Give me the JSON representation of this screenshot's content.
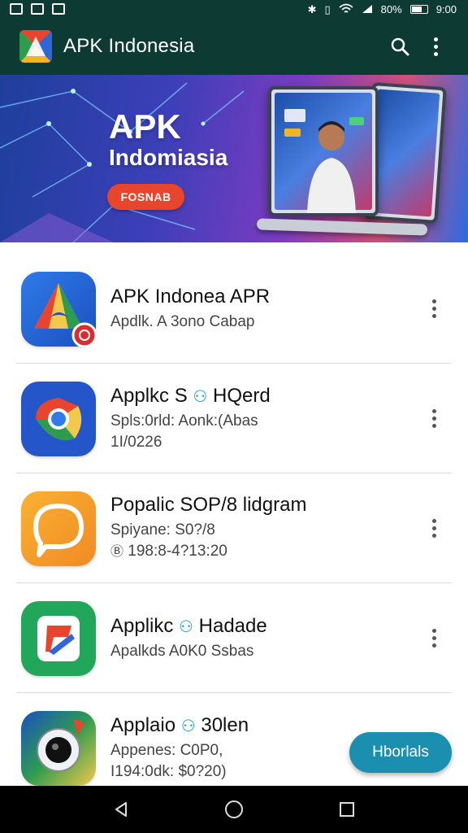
{
  "status_bar": {
    "battery": "80%",
    "time": "9:00"
  },
  "app_bar": {
    "title": "APK Indonesia"
  },
  "banner": {
    "title": "APK",
    "subtitle": "Indomiasia",
    "cta_label": "FOSNAB"
  },
  "apps": [
    {
      "title": "APK  Indonea APR",
      "line1": "Apdlk. A 3ono Cabap",
      "line2": ""
    },
    {
      "title": "Applkc S",
      "title_suffix": "HQerd",
      "line1": "Spls:0rld: Aonk:(Abas",
      "line2": "1I/0226"
    },
    {
      "title": "Popalic SOP/8 lidgram",
      "line1": "Spiyane: S0?/8",
      "line2": "198:8-4?13:20"
    },
    {
      "title": "Applikc",
      "title_suffix": "Hadade",
      "line1": "Apalkds A0K0 Ssbas",
      "line2": ""
    },
    {
      "title": "Applaio",
      "title_suffix": "30len",
      "line1": "Appenes: C0P0,",
      "line2": "I194:0dk: $0?20)"
    }
  ],
  "fab_label": "Hborlals",
  "colors": {
    "app_bar": "#0d3b33",
    "fab": "#1b8fb0",
    "cta": "#e8452e"
  }
}
